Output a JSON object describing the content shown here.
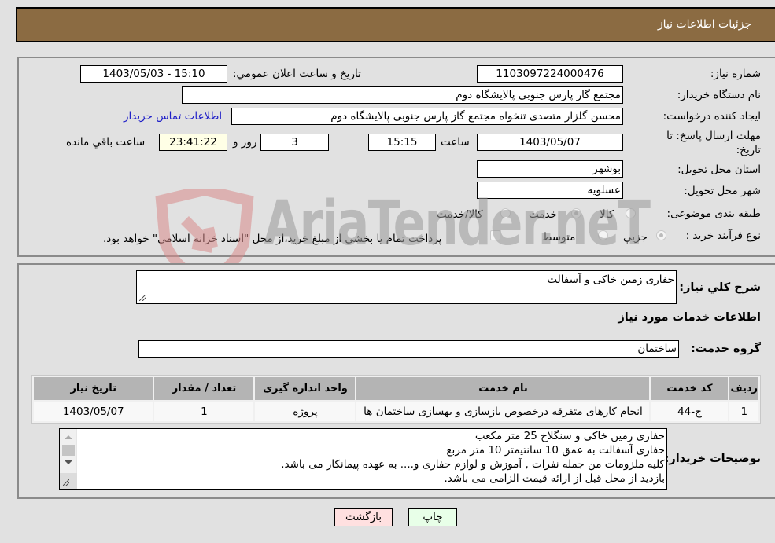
{
  "header": {
    "title": "جزئیات اطلاعات نیاز"
  },
  "details": {
    "need_number_label": "شماره نیاز:",
    "need_number": "1103097224000476",
    "announce_label": "تاریخ و ساعت اعلان عمومي:",
    "announce_value": "1403/05/03 - 15:10",
    "buyer_org_label": "نام دستگاه خریدار:",
    "buyer_org": "مجتمع گاز پارس جنوبی  پالایشگاه دوم",
    "creator_label": "ایجاد کننده درخواست:",
    "creator": "محسن گلزار متصدی تنخواه مجتمع گاز پارس جنوبی  پالایشگاه دوم",
    "contact_link": "اطلاعات تماس خریدار",
    "deadline_label_1": "مهلت ارسال پاسخ: تا",
    "deadline_label_2": "تاریخ:",
    "deadline_date": "1403/05/07",
    "time_label": "ساعت",
    "deadline_time": "15:15",
    "days_value": "3",
    "days_label": "روز و",
    "remaining_time": "23:41:22",
    "remaining_label": "ساعت باقي مانده",
    "province_label": "استان محل تحویل:",
    "province": "بوشهر",
    "city_label": "شهر محل تحویل:",
    "city": "عسلویه",
    "category_label": "طبقه بندی موضوعی:",
    "category_options": [
      {
        "label": "کالا",
        "checked": false
      },
      {
        "label": "خدمت",
        "checked": true
      },
      {
        "label": "کالا/خدمت",
        "checked": false
      }
    ],
    "process_label": "نوع فرآیند خرید :",
    "process_options": [
      {
        "label": "جزيي",
        "checked": true
      },
      {
        "label": "متوسط",
        "checked": false
      }
    ],
    "treasury_note": "پرداخت تمام یا بخشی از مبلغ خرید،از محل \"اسناد خزانه اسلامی\" خواهد بود.",
    "treasury_checked": false
  },
  "description": {
    "label": "شرح کلي نیاز:",
    "value": "حفاری زمین خاکی و آسفالت"
  },
  "services": {
    "section_title": "اطلاعات خدمات مورد نیاز",
    "group_label": "گروه خدمت:",
    "group_value": "ساختمان",
    "columns": [
      "ردیف",
      "کد خدمت",
      "نام خدمت",
      "واحد اندازه گیری",
      "تعداد / مقدار",
      "تاریخ نیاز"
    ],
    "rows": [
      [
        "1",
        "ج-44",
        "انجام کارهای متفرقه درخصوص بازسازی و بهسازی ساختمان ها",
        "پروژه",
        "1",
        "1403/05/07"
      ]
    ]
  },
  "buyer_notes": {
    "label": "توضیحات خریدار:",
    "lines": [
      "حفاری زمین خاکی و سنگلاخ   25 متر مکعب",
      "حفاری آسفالت به عمق 10 سانتیمتر   10 متر مربع",
      "کلیه ملزومات من جمله نفرات , آموزش و لوازم حفاری و.... به عهده پیمانکار می باشد.",
      "بازدید از محل قبل از ارائه قیمت الزامی می باشد."
    ]
  },
  "buttons": {
    "print": "چاپ",
    "back": "بازگشت"
  },
  "watermark": {
    "text": "AriaTender.neT"
  }
}
